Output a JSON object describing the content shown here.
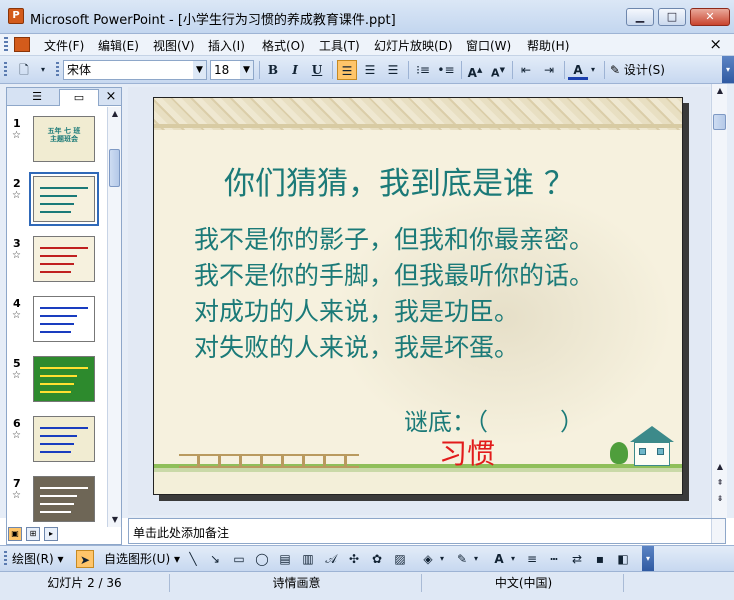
{
  "window": {
    "title": "Microsoft PowerPoint - [小学生行为习惯的养成教育课件.ppt]",
    "app_icon": "powerpoint-icon",
    "controls": [
      "minimize",
      "maximize",
      "close"
    ]
  },
  "menu": {
    "items": [
      "文件(F)",
      "编辑(E)",
      "视图(V)",
      "插入(I)",
      "格式(O)",
      "工具(T)",
      "幻灯片放映(D)",
      "窗口(W)",
      "帮助(H)"
    ],
    "close_glyph": "×"
  },
  "format_toolbar": {
    "font": "宋体",
    "size": "18",
    "bold": "B",
    "italic": "I",
    "underline": "U",
    "font_color_label": "A",
    "design_label": "设计(S)",
    "align_left_active": true
  },
  "left_pane": {
    "tabs": [
      "outline-tab",
      "slides-tab"
    ],
    "active_tab": "slides-tab",
    "close_glyph": "×",
    "slides": [
      {
        "number": "1",
        "thumb_title": "五年 七 班\n主题班会",
        "bg": "#f1ecd2",
        "title_color": "#1b7a78"
      },
      {
        "number": "2",
        "thumb_title": "",
        "bg": "#f6f1de",
        "title_color": "#1b7a78",
        "selected": true
      },
      {
        "number": "3",
        "thumb_title": "",
        "bg": "#f6f1de",
        "title_color": "#c02020"
      },
      {
        "number": "4",
        "thumb_title": "",
        "bg": "#ffffff",
        "title_color": "#1a3dbf"
      },
      {
        "number": "5",
        "thumb_title": "",
        "bg": "#2d8a2d",
        "title_color": "#ffe030"
      },
      {
        "number": "6",
        "thumb_title": "",
        "bg": "#f1ecd2",
        "title_color": "#1a3dbf"
      },
      {
        "number": "7",
        "thumb_title": "",
        "bg": "#6e6656",
        "title_color": "#ffffff"
      }
    ]
  },
  "slide": {
    "title": "你们猜猜，我到底是谁 ？",
    "lines": [
      "我不是你的影子，但我和你最亲密。",
      "我不是你的手脚，但我最听你的话。",
      "对成功的人来说，我是功臣。",
      "对失败的人来说，我是坏蛋。"
    ],
    "riddle": "谜底：（　　　）",
    "answer": "习惯",
    "text_color": "#1b7a78",
    "answer_color": "#e21b1b"
  },
  "notes": {
    "placeholder": "单击此处添加备注"
  },
  "drawing_toolbar": {
    "draw_label": "绘图(R)",
    "autoshapes_label": "自选图形(U)"
  },
  "status": {
    "slide_indicator": "幻灯片 2 / 36",
    "design_name": "诗情画意",
    "language": "中文(中国)"
  }
}
